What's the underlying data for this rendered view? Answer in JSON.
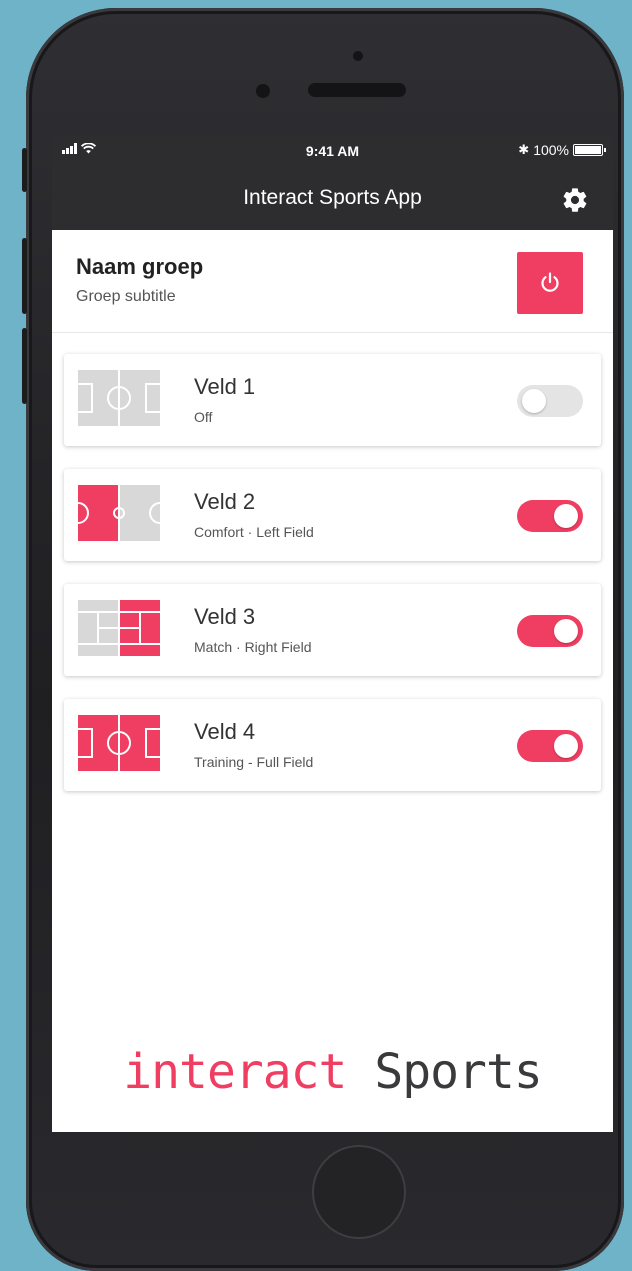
{
  "status_bar": {
    "time": "9:41 AM",
    "bluetooth_symbol": "✱",
    "battery": "100%"
  },
  "app_bar": {
    "title": "Interact Sports App",
    "settings_icon": "gear-icon"
  },
  "group": {
    "title": "Naam groep",
    "subtitle": "Groep subtitle",
    "power_icon": "power-icon",
    "power_color": "#f03e62"
  },
  "fields": [
    {
      "title": "Veld 1",
      "subtitle": "Off",
      "enabled": false
    },
    {
      "title": "Veld 2",
      "subtitle": "Comfort · Left Field",
      "enabled": true
    },
    {
      "title": "Veld 3",
      "subtitle": "Match · Right Field",
      "enabled": true
    },
    {
      "title": "Veld 4",
      "subtitle": "Training - Full Field",
      "enabled": true
    }
  ],
  "brand": {
    "accent_word": "interact",
    "word": "Sports"
  },
  "colors": {
    "accent": "#f03e62",
    "dark_bar": "#2d2d2f",
    "inactive": "#d8d8d8"
  }
}
